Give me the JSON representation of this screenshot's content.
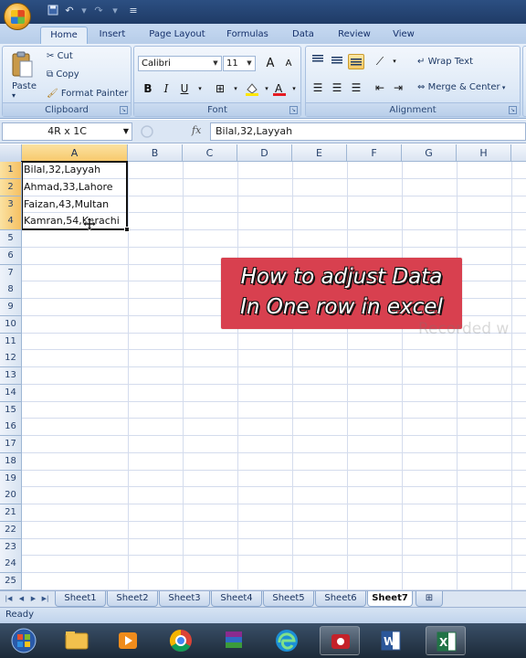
{
  "app": {
    "ribbon_tabs": [
      "Home",
      "Insert",
      "Page Layout",
      "Formulas",
      "Data",
      "Review",
      "View"
    ],
    "active_tab": "Home"
  },
  "clipboard": {
    "paste": "Paste",
    "cut": "Cut",
    "copy": "Copy",
    "format_painter": "Format Painter",
    "label": "Clipboard"
  },
  "font": {
    "name": "Calibri",
    "size": "11",
    "label": "Font",
    "bold": "B",
    "italic": "I",
    "underline": "U",
    "grow": "A",
    "shrink": "A"
  },
  "alignment": {
    "wrap_text": "Wrap Text",
    "merge_center": "Merge & Center",
    "label": "Alignment"
  },
  "formula_bar": {
    "name_box": "4R x 1C",
    "fx": "fx",
    "content": "Bilal,32,Layyah"
  },
  "columns": [
    "A",
    "B",
    "C",
    "D",
    "E",
    "F",
    "G",
    "H"
  ],
  "rows": [
    "1",
    "2",
    "3",
    "4",
    "5",
    "6",
    "7",
    "8",
    "9",
    "10",
    "11",
    "12",
    "13",
    "14",
    "15",
    "16",
    "17",
    "18",
    "19",
    "20",
    "21",
    "22",
    "23",
    "24",
    "25"
  ],
  "cells": [
    {
      "ref": "A1",
      "value": "Bilal,32,Layyah"
    },
    {
      "ref": "A2",
      "value": "Ahmad,33,Lahore"
    },
    {
      "ref": "A3",
      "value": "Faizan,43,Multan"
    },
    {
      "ref": "A4",
      "value": "Kamran,54,Karachi"
    }
  ],
  "overlay": {
    "line1": "How to adjust Data",
    "line2": "In One row in excel",
    "watermark": "Recorded w"
  },
  "sheets": [
    "Sheet1",
    "Sheet2",
    "Sheet3",
    "Sheet4",
    "Sheet5",
    "Sheet6",
    "Sheet7"
  ],
  "active_sheet": "Sheet7",
  "status": "Ready",
  "taskbar_icons": [
    "windows-start-icon",
    "file-explorer-icon",
    "media-player-icon",
    "chrome-icon",
    "winrar-icon",
    "edge-icon",
    "screen-recorder-icon",
    "word-icon",
    "excel-icon"
  ],
  "colors": {
    "accent": "#d8404f",
    "selection_header": "#f7c86a",
    "ribbon": "#d3e2f4",
    "title": "#1f3b66"
  }
}
